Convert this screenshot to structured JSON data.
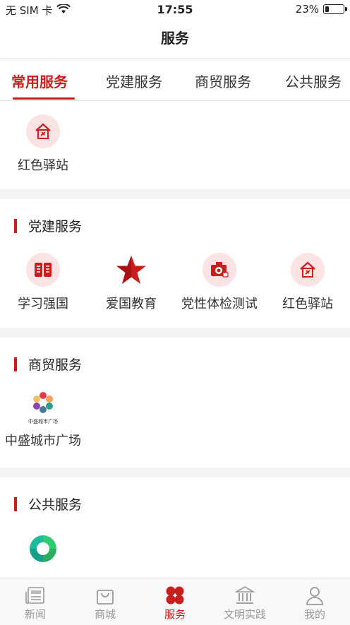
{
  "status_bar": {
    "carrier": "无 SIM 卡",
    "time": "17:55",
    "battery": "23%",
    "battery_level": 0.23
  },
  "header": {
    "title": "服务"
  },
  "tabs": [
    {
      "label": "常用服务",
      "active": true
    },
    {
      "label": "党建服务"
    },
    {
      "label": "商贸服务"
    },
    {
      "label": "公共服务"
    }
  ],
  "common": {
    "items": [
      {
        "label": "红色驿站",
        "icon": "red-station-icon"
      }
    ]
  },
  "party": {
    "title": "党建服务",
    "items": [
      {
        "label": "学习强国",
        "icon": "book-icon"
      },
      {
        "label": "爱国教育",
        "icon": "star-icon"
      },
      {
        "label": "党性体检测试",
        "icon": "checkup-icon"
      },
      {
        "label": "红色驿站",
        "icon": "red-station-icon"
      }
    ]
  },
  "trade": {
    "title": "商贸服务",
    "items": [
      {
        "label": "中盛城市广场",
        "icon": "zhongsheng-logo",
        "logo_text": "中盛城市广场"
      }
    ]
  },
  "public": {
    "title": "公共服务",
    "items": [
      {
        "label": "",
        "icon": "swirl-logo-icon"
      }
    ]
  },
  "tabbar": [
    {
      "label": "新闻",
      "icon": "news-icon"
    },
    {
      "label": "商城",
      "icon": "shopping-bag-icon"
    },
    {
      "label": "服务",
      "icon": "service-icon",
      "active": true
    },
    {
      "label": "文明实践",
      "icon": "building-icon"
    },
    {
      "label": "我的",
      "icon": "person-icon"
    }
  ],
  "colors": {
    "accent": "#c81e1e",
    "icon_bg": "#fbe3e3",
    "gap": "#f3f3f3"
  }
}
